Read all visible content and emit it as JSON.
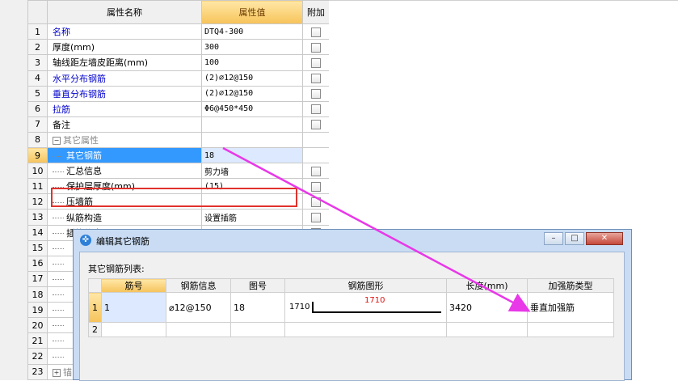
{
  "grid": {
    "header": {
      "name": "属性名称",
      "value": "属性值",
      "extra": "附加"
    },
    "rows": [
      {
        "num": "1",
        "name": "名称",
        "value": "DTQ4-300"
      },
      {
        "num": "2",
        "name": "厚度(mm)",
        "value": "300"
      },
      {
        "num": "3",
        "name": "轴线距左墙皮距离(mm)",
        "value": "100"
      },
      {
        "num": "4",
        "name": "水平分布钢筋",
        "value": "(2)⌀12@150"
      },
      {
        "num": "5",
        "name": "垂直分布钢筋",
        "value": "(2)⌀12@150"
      },
      {
        "num": "6",
        "name": "拉筋",
        "value": "Φ6@450*450"
      },
      {
        "num": "7",
        "name": "备注",
        "value": ""
      },
      {
        "num": "8",
        "name": "其它属性",
        "value": ""
      },
      {
        "num": "9",
        "name": "其它钢筋",
        "value": "18"
      },
      {
        "num": "10",
        "name": "汇总信息",
        "value": "剪力墙"
      },
      {
        "num": "11",
        "name": "保护层厚度(mm)",
        "value": "(15)"
      },
      {
        "num": "12",
        "name": "压墙筋",
        "value": ""
      },
      {
        "num": "13",
        "name": "纵筋构造",
        "value": "设置插筋"
      },
      {
        "num": "14",
        "name": "插筋信息",
        "value": ""
      },
      {
        "num": "15",
        "name": "",
        "value": ""
      },
      {
        "num": "16",
        "name": "",
        "value": ""
      },
      {
        "num": "17",
        "name": "",
        "value": ""
      },
      {
        "num": "18",
        "name": "",
        "value": ""
      },
      {
        "num": "19",
        "name": "",
        "value": ""
      },
      {
        "num": "20",
        "name": "",
        "value": ""
      },
      {
        "num": "21",
        "name": "",
        "value": ""
      },
      {
        "num": "22",
        "name": "",
        "value": ""
      },
      {
        "num": "23",
        "name": "锚",
        "value": ""
      }
    ]
  },
  "dialog": {
    "title": "编辑其它钢筋",
    "list_label": "其它钢筋列表:",
    "columns": [
      "筋号",
      "钢筋信息",
      "图号",
      "钢筋图形",
      "长度(mm)",
      "加强筋类型"
    ],
    "row1": {
      "num": "1",
      "bar_no": "1",
      "bar_info": "⌀12@150",
      "figure_no": "18",
      "shape_left": "1710",
      "shape_mid": "1710",
      "length": "3420",
      "type": "垂直加强筋"
    },
    "row2": {
      "num": "2"
    },
    "buttons": {
      "min": "–",
      "max": "□",
      "close": "✕"
    }
  },
  "colors": {
    "arrow": "#e838e8",
    "highlight": "#e0322c",
    "selected_header": "#f5c35c"
  }
}
